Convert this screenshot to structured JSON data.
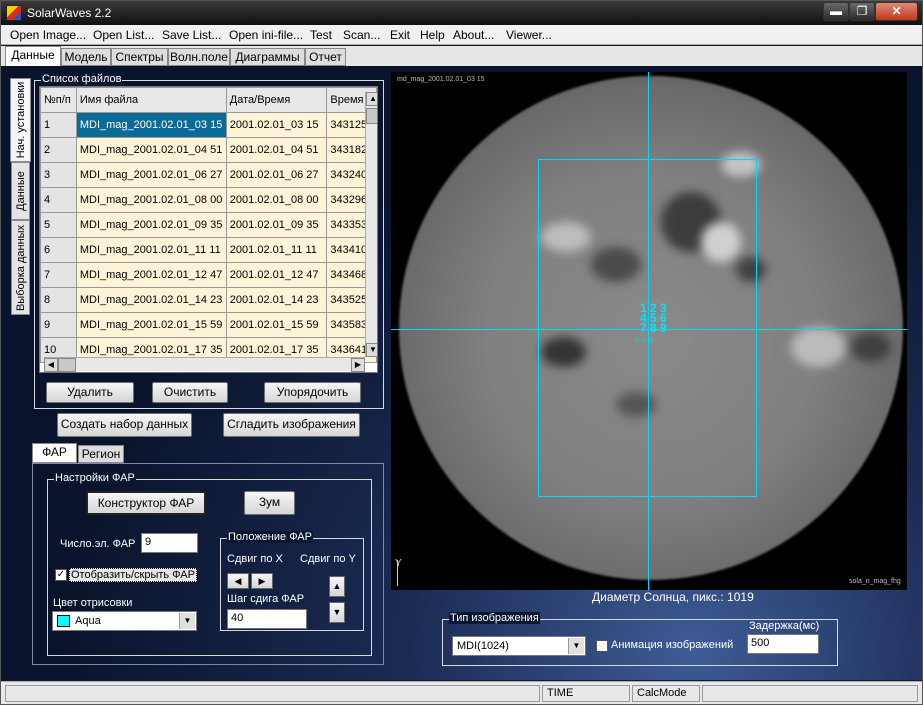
{
  "window": {
    "title": "SolarWaves 2.2",
    "min": "▬",
    "max": "❐",
    "close": "✕"
  },
  "menu": [
    "Open Image...",
    "Open List...",
    "Save List...",
    "Open ini-file...",
    "Test",
    "Scan...",
    "Exit",
    "Help",
    "About...",
    "Viewer..."
  ],
  "main_tabs": [
    "Данные",
    "Модель",
    "Спектры",
    "Волн.поле",
    "Диаграммы",
    "Отчет"
  ],
  "vertical_tabs": [
    "Нач. установки",
    "Данные",
    "Выборка данных"
  ],
  "file_list": {
    "legend": "Список файлов",
    "columns": [
      "№п/п",
      "Имя файла",
      "Дата/Время",
      "Время"
    ],
    "rows": [
      [
        "1",
        "MDI_mag_2001.02.01_03 15",
        "2001.02.01_03 15",
        "343125"
      ],
      [
        "2",
        "MDI_mag_2001.02.01_04 51",
        "2001.02.01_04 51",
        "343182"
      ],
      [
        "3",
        "MDI_mag_2001.02.01_06 27",
        "2001.02.01_06 27",
        "343240"
      ],
      [
        "4",
        "MDI_mag_2001.02.01_08 00",
        "2001.02.01_08 00",
        "343296"
      ],
      [
        "5",
        "MDI_mag_2001.02.01_09 35",
        "2001.02.01_09 35",
        "343353"
      ],
      [
        "6",
        "MDI_mag_2001.02.01_11 11",
        "2001.02.01_11 11",
        "343410"
      ],
      [
        "7",
        "MDI_mag_2001.02.01_12 47",
        "2001.02.01_12 47",
        "343468"
      ],
      [
        "8",
        "MDI_mag_2001.02.01_14 23",
        "2001.02.01_14 23",
        "343525"
      ],
      [
        "9",
        "MDI_mag_2001.02.01_15 59",
        "2001.02.01_15 59",
        "343583"
      ],
      [
        "10",
        "MDI_mag_2001.02.01_17 35",
        "2001.02.01_17 35",
        "343641"
      ]
    ],
    "buttons": {
      "delete": "Удалить",
      "clear": "Очистить",
      "sort": "Упорядочить"
    }
  },
  "actions": {
    "create_dataset": "Создать набор данных",
    "smooth_images": "Сгладить изображения"
  },
  "sub_tabs": [
    "ФАР",
    "Регион"
  ],
  "far_settings": {
    "legend": "Настройки ФАР",
    "constructor_button": "Конструктор ФАР",
    "zoom_button": "Зум",
    "num_elements_label": "Число.эл. ФАР",
    "num_elements_value": "9",
    "toggle_label": "Отобразить/скрыть ФАР",
    "toggle_checked": true,
    "color_label": "Цвет отрисовки",
    "color_value": "Aqua",
    "color_hex": "#00ffff"
  },
  "far_position": {
    "legend": "Положение ФАР",
    "shift_x_label": "Сдвиг по X",
    "shift_y_label": "Сдвиг по Y",
    "step_label": "Шаг сдига ФАР",
    "step_value": "40"
  },
  "viewer": {
    "top_label": "md_mag_2001.02.01_03 15",
    "bottom_label": "sola_n_mag_fhg",
    "axis_label": "Y",
    "numbers": [
      "1 2 3",
      "4 5 6",
      "7 8 9"
    ],
    "diameter_text": "Диаметр Солнца, пикс.: 1019",
    "crosshair_color": "#00d8ff"
  },
  "image_type": {
    "legend": "Тип изображения",
    "value": "MDI(1024)",
    "animation_label": "Анимация изображений",
    "animation_checked": false,
    "delay_label": "Задержка(мс)",
    "delay_value": "500"
  },
  "status": {
    "time": "TIME",
    "calc": "CalcMode"
  },
  "scroll_arrows": {
    "up": "▲",
    "down": "▼",
    "left": "◀",
    "right": "▶"
  }
}
